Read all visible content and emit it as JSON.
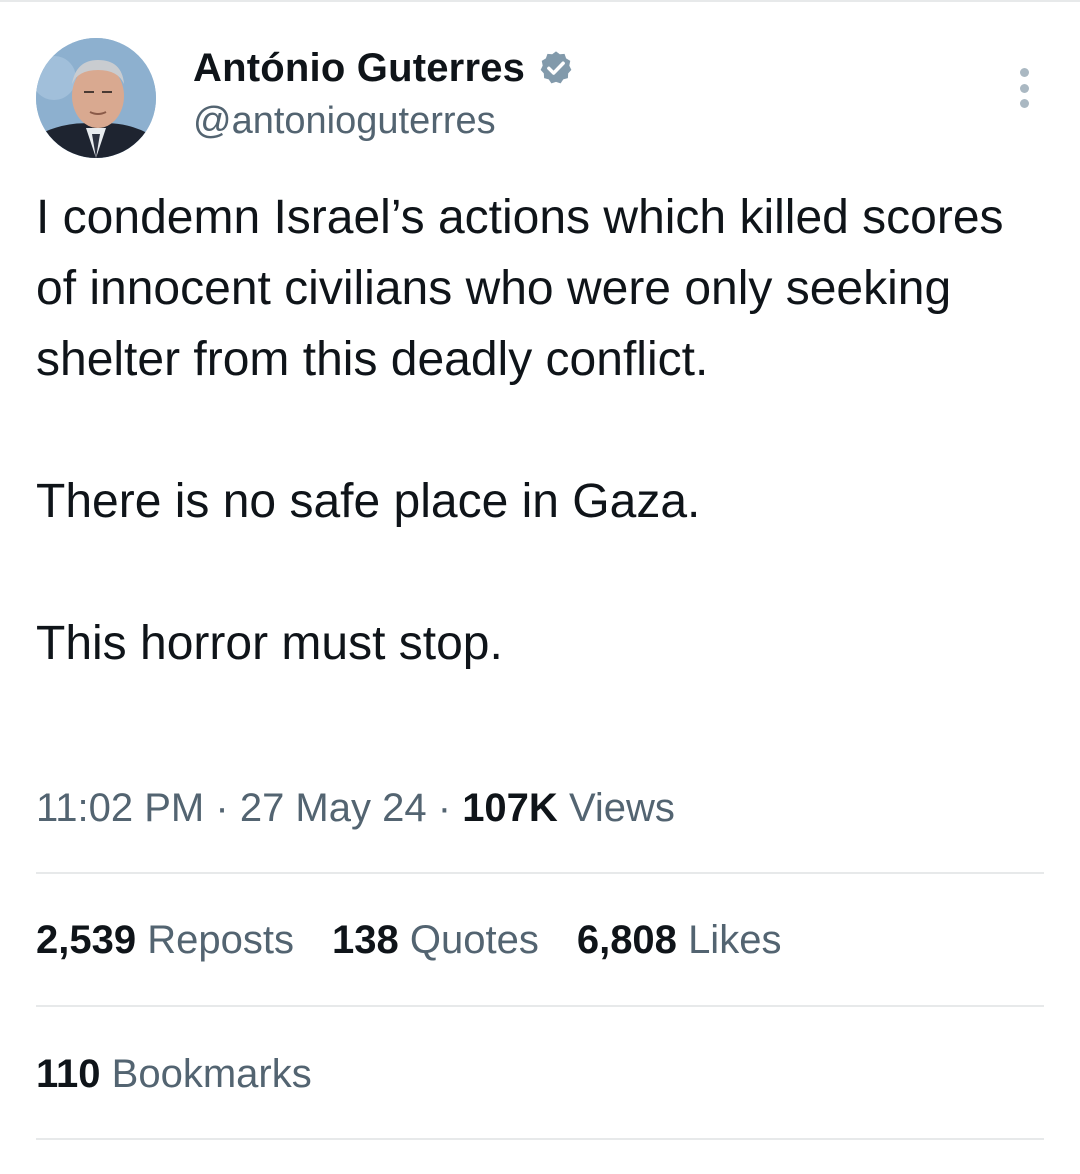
{
  "author": {
    "display_name": "António Guterres",
    "handle": "@antonioguterres",
    "verified": true
  },
  "icons": {
    "verified": "verified-badge-icon",
    "more": "more-options-icon",
    "avatar": "avatar-photo"
  },
  "tweet": {
    "paragraphs": [
      "I condemn Israel’s actions which killed scores of innocent civilians who were only seeking shelter from this deadly conflict.",
      "There is no safe place in Gaza.",
      "This horror must stop."
    ]
  },
  "meta": {
    "time": "11:02 PM",
    "separator": "·",
    "date": "27 May 24",
    "views_count": "107K",
    "views_label": "Views"
  },
  "stats": {
    "reposts_count": "2,539",
    "reposts_label": "Reposts",
    "quotes_count": "138",
    "quotes_label": "Quotes",
    "likes_count": "6,808",
    "likes_label": "Likes",
    "bookmarks_count": "110",
    "bookmarks_label": "Bookmarks"
  },
  "colors": {
    "text_primary": "#0f1419",
    "text_secondary": "#536471",
    "divider": "#e7e9ea",
    "verified_badge": "#829aab"
  }
}
